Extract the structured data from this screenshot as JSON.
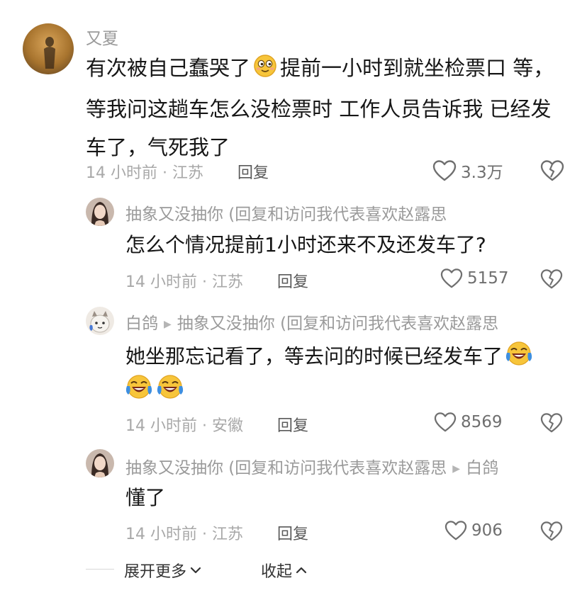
{
  "comments": [
    {
      "username": "又夏",
      "lines": [
        "有次被自己蠢哭了",
        "提前一小时到就坐检票口 等，",
        "等我问这趟车怎么没检票时 工作人员告诉我 已经发",
        "车了，气死我了"
      ],
      "time_location": "14 小时前 · 江苏",
      "reply_label": "回复",
      "likes": "3.3万"
    },
    {
      "username": "抽象又没抽你 (回复和访问我代表喜欢赵露思",
      "text": "怎么个情况提前1小时还来不及还发车了?",
      "time_location": "14 小时前 · 江苏",
      "reply_label": "回复",
      "likes": "5157"
    },
    {
      "username": "白鸽",
      "reply_to": "抽象又没抽你 (回复和访问我代表喜欢赵露思",
      "text": "她坐那忘记看了，等去问的时候已经发车了",
      "time_location": "14 小时前 · 安徽",
      "reply_label": "回复",
      "likes": "8569"
    },
    {
      "username": "抽象又没抽你 (回复和访问我代表喜欢赵露思",
      "reply_to": "白鸽",
      "text": "懂了",
      "time_location": "14 小时前 · 江苏",
      "reply_label": "回复",
      "likes": "906"
    }
  ],
  "footer": {
    "expand_label": "展开更多",
    "collapse_label": "收起"
  },
  "colors": {
    "username": "#9a9a9a",
    "text": "#161616",
    "meta": "#a8a8a8"
  },
  "icons": [
    "heart-icon",
    "dislike-heart-icon",
    "emoji-smile-icon",
    "emoji-laugh-cry-icon",
    "chevron-down-icon",
    "chevron-up-icon"
  ]
}
